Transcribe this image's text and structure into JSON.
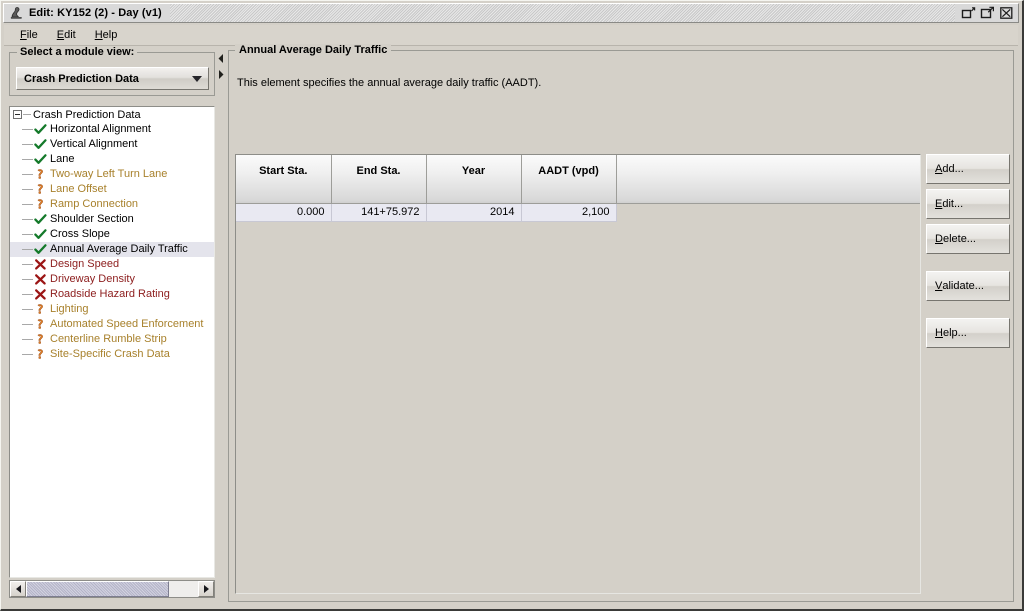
{
  "window": {
    "title": "Edit: KY152 (2) - Day (v1)",
    "icon": "java-duke-icon",
    "controls": [
      {
        "name": "minimize-restore-button",
        "icon": "restore-down-icon"
      },
      {
        "name": "maximize-button",
        "icon": "maximize-icon"
      },
      {
        "name": "close-button",
        "icon": "close-icon"
      }
    ]
  },
  "menubar": {
    "items": [
      {
        "label": "File",
        "mnemonic": "F",
        "rest": "ile"
      },
      {
        "label": "Edit",
        "mnemonic": "E",
        "rest": "dit"
      },
      {
        "label": "Help",
        "mnemonic": "H",
        "rest": "elp"
      }
    ]
  },
  "sidebar": {
    "group_title": "Select a module view:",
    "module_combo": {
      "selected": "Crash Prediction Data",
      "icon": "chevron-down-icon"
    },
    "tree": {
      "root": "Crash Prediction Data",
      "root_expanded": true,
      "items": [
        {
          "label": "Horizontal Alignment",
          "status": "ok",
          "icon": "green-check-icon",
          "selected": false
        },
        {
          "label": "Vertical Alignment",
          "status": "ok",
          "icon": "green-check-icon",
          "selected": false
        },
        {
          "label": "Lane",
          "status": "ok",
          "icon": "green-check-icon",
          "selected": false
        },
        {
          "label": "Two-way Left Turn Lane",
          "status": "warning",
          "icon": "orange-question-icon",
          "selected": false
        },
        {
          "label": "Lane Offset",
          "status": "warning",
          "icon": "orange-question-icon",
          "selected": false
        },
        {
          "label": "Ramp Connection",
          "status": "warning",
          "icon": "orange-question-icon",
          "selected": false
        },
        {
          "label": "Shoulder Section",
          "status": "ok",
          "icon": "green-check-icon",
          "selected": false
        },
        {
          "label": "Cross Slope",
          "status": "ok",
          "icon": "green-check-icon",
          "selected": false
        },
        {
          "label": "Annual Average Daily Traffic",
          "status": "ok",
          "icon": "green-check-icon",
          "selected": true
        },
        {
          "label": "Design Speed",
          "status": "error",
          "icon": "red-x-icon",
          "selected": false
        },
        {
          "label": "Driveway Density",
          "status": "error",
          "icon": "red-x-icon",
          "selected": false
        },
        {
          "label": "Roadside Hazard Rating",
          "status": "error",
          "icon": "red-x-icon",
          "selected": false
        },
        {
          "label": "Lighting",
          "status": "warning",
          "icon": "orange-question-icon",
          "selected": false
        },
        {
          "label": "Automated Speed Enforcement",
          "status": "warning",
          "icon": "orange-question-icon",
          "selected": false
        },
        {
          "label": "Centerline Rumble Strip",
          "status": "warning",
          "icon": "orange-question-icon",
          "selected": false
        },
        {
          "label": "Site-Specific Crash Data",
          "status": "warning",
          "icon": "orange-question-icon",
          "selected": false
        }
      ]
    },
    "scrollbar": {
      "left_icon": "triangle-left-icon",
      "right_icon": "triangle-right-icon"
    }
  },
  "splitter": {
    "collapse_left_icon": "splitter-left-arrow-icon",
    "collapse_right_icon": "splitter-right-arrow-icon"
  },
  "main": {
    "group_title": "Annual Average Daily Traffic",
    "description": "This element specifies the annual average daily traffic (AADT).",
    "table": {
      "columns": [
        "Start Sta.",
        "End Sta.",
        "Year",
        "AADT (vpd)",
        ""
      ],
      "rows": [
        {
          "selected": true,
          "cells": [
            "0.000",
            "141+75.972",
            "2014",
            "2,100",
            ""
          ]
        }
      ]
    },
    "buttons": [
      {
        "label": "Add...",
        "mnemonic": "A",
        "rest": "dd...",
        "name": "add-button"
      },
      {
        "label": "Edit...",
        "mnemonic": "E",
        "rest": "dit...",
        "name": "edit-button"
      },
      {
        "label": "Delete...",
        "mnemonic": "D",
        "rest": "elete...",
        "name": "delete-button"
      },
      {
        "label": "Validate...",
        "mnemonic": "V",
        "rest": "alidate...",
        "name": "validate-button"
      },
      {
        "label": "Help...",
        "mnemonic": "H",
        "rest": "elp...",
        "name": "help-button"
      }
    ]
  },
  "colors": {
    "window_bg": "#d4d0c8",
    "status_ok": "#157a2b",
    "status_warning": "#a8812c",
    "status_error": "#8e2020",
    "row_selected": "#e9e9f2"
  }
}
